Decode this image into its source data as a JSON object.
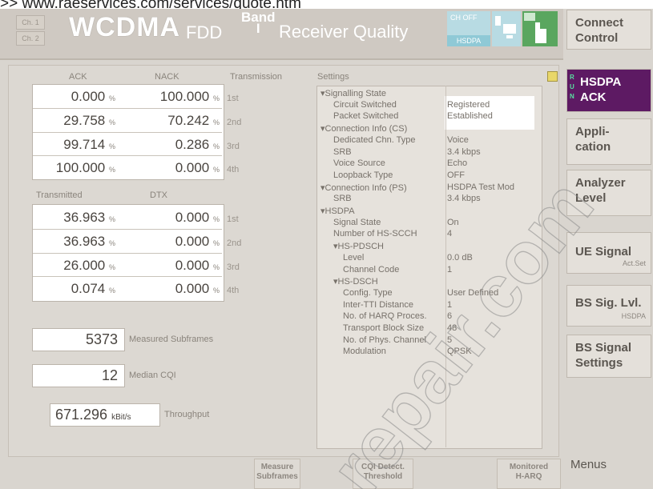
{
  "url_text": ">> www.raeservices.com/services/quote.htm",
  "channels": [
    "Ch. 1",
    "Ch. 2"
  ],
  "title": {
    "main": "WCDMA",
    "fdd": "FDD",
    "band_word": "Band",
    "band_num": "I",
    "subtitle": "Receiver Quality"
  },
  "status": {
    "top": "CH OFF",
    "bottom": "HSDPA"
  },
  "right_menu": [
    {
      "label": "Connect\nControl",
      "sub": ""
    },
    {
      "label": "HSDPA\nACK",
      "sub": "",
      "run": "R\nU\nN"
    },
    {
      "label": "Appli-\ncation",
      "sub": ""
    },
    {
      "label": "Analyzer\nLevel",
      "sub": ""
    },
    {
      "label": "UE Signal",
      "sub": "Act.Set"
    },
    {
      "label": "BS Sig. Lvl.",
      "sub": "HSDPA"
    },
    {
      "label": "BS Signal\nSettings",
      "sub": ""
    }
  ],
  "ack_table": {
    "headers": [
      "ACK",
      "NACK",
      "Transmission"
    ],
    "rows": [
      {
        "ack": "0.000",
        "nack": "100.000",
        "tx": "1st"
      },
      {
        "ack": "29.758",
        "nack": "70.242",
        "tx": "2nd"
      },
      {
        "ack": "99.714",
        "nack": "0.286",
        "tx": "3rd"
      },
      {
        "ack": "100.000",
        "nack": "0.000",
        "tx": "4th"
      }
    ],
    "unit": "%"
  },
  "dtx_table": {
    "headers": [
      "Transmitted",
      "DTX"
    ],
    "rows": [
      {
        "tr": "36.963",
        "dtx": "0.000",
        "tx": "1st"
      },
      {
        "tr": "36.963",
        "dtx": "0.000",
        "tx": "2nd"
      },
      {
        "tr": "26.000",
        "dtx": "0.000",
        "tx": "3rd"
      },
      {
        "tr": "0.074",
        "dtx": "0.000",
        "tx": "4th"
      }
    ]
  },
  "stats": {
    "subframes": {
      "value": "5373",
      "label": "Measured Subframes"
    },
    "cqi": {
      "value": "12",
      "label": "Median CQI"
    },
    "throughput": {
      "value": "671.296",
      "unit": "kBit/s",
      "label": "Throughput"
    }
  },
  "settings": {
    "title": "Settings",
    "rows": [
      {
        "k": "▾Signalling State",
        "v": "",
        "indent": 0
      },
      {
        "k": "Circuit Switched",
        "v": "Registered",
        "indent": 1
      },
      {
        "k": "Packet Switched",
        "v": "Established",
        "indent": 1
      },
      {
        "k": "▾Connection Info (CS)",
        "v": "",
        "indent": 0
      },
      {
        "k": "Dedicated Chn. Type",
        "v": "Voice",
        "indent": 1
      },
      {
        "k": "SRB",
        "v": "3.4 kbps",
        "indent": 1
      },
      {
        "k": "Voice Source",
        "v": "Echo",
        "indent": 1
      },
      {
        "k": "Loopback Type",
        "v": "OFF",
        "indent": 1
      },
      {
        "k": "▾Connection Info (PS)",
        "v": "HSDPA Test Mod",
        "indent": 0
      },
      {
        "k": "SRB",
        "v": "3.4 kbps",
        "indent": 1
      },
      {
        "k": "▾HSDPA",
        "v": "",
        "indent": 0
      },
      {
        "k": "Signal State",
        "v": "On",
        "indent": 1
      },
      {
        "k": "Number of HS-SCCH",
        "v": "4",
        "indent": 1
      },
      {
        "k": "▾HS-PDSCH",
        "v": "",
        "indent": 1
      },
      {
        "k": "Level",
        "v": "0.0 dB",
        "indent": 2
      },
      {
        "k": "Channel Code",
        "v": "1",
        "indent": 2
      },
      {
        "k": "▾HS-DSCH",
        "v": "",
        "indent": 1
      },
      {
        "k": "Config. Type",
        "v": "User Defined",
        "indent": 2
      },
      {
        "k": "Inter-TTI Distance",
        "v": "1",
        "indent": 2
      },
      {
        "k": "No. of HARQ Proces.",
        "v": "6",
        "indent": 2
      },
      {
        "k": "Transport Block Size",
        "v": "48",
        "indent": 2
      },
      {
        "k": "No. of Phys. Channel",
        "v": "5",
        "indent": 2
      },
      {
        "k": "Modulation",
        "v": "QPSK",
        "indent": 2
      }
    ]
  },
  "softkeys": [
    {
      "l1": "Measure",
      "l2": "Subframes"
    },
    {
      "l1": "CQI Detect.",
      "l2": "Threshold"
    },
    {
      "l1": "Monitored",
      "l2": "H-ARQ"
    }
  ],
  "menus_label": "Menus",
  "watermark": "repair.com"
}
